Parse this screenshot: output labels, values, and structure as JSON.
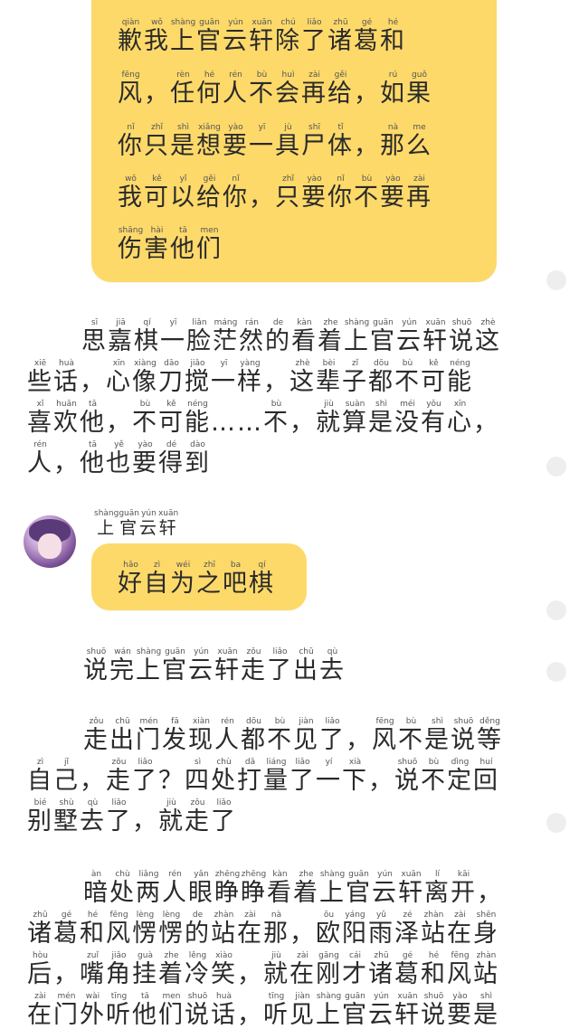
{
  "top_bubble": {
    "lines": [
      [
        [
          "歉",
          "qiàn"
        ],
        [
          "我",
          "wǒ"
        ],
        [
          "上",
          "shàng"
        ],
        [
          "官",
          "guān"
        ],
        [
          "云",
          "yún"
        ],
        [
          "轩",
          "xuān"
        ],
        [
          "除",
          "chú"
        ],
        [
          "了",
          "liǎo"
        ],
        [
          "诸",
          "zhū"
        ],
        [
          "葛",
          "gé"
        ],
        [
          "和",
          "hé"
        ]
      ],
      [
        [
          "风",
          "fēng"
        ],
        [
          "，",
          ""
        ],
        [
          "任",
          "rèn"
        ],
        [
          "何",
          "hé"
        ],
        [
          "人",
          "rén"
        ],
        [
          "不",
          "bù"
        ],
        [
          "会",
          "huì"
        ],
        [
          "再",
          "zài"
        ],
        [
          "给",
          "gěi"
        ],
        [
          "，",
          ""
        ],
        [
          "如",
          "rú"
        ],
        [
          "果",
          "guǒ"
        ]
      ],
      [
        [
          "你",
          "nǐ"
        ],
        [
          "只",
          "zhǐ"
        ],
        [
          "是",
          "shì"
        ],
        [
          "想",
          "xiǎng"
        ],
        [
          "要",
          "yào"
        ],
        [
          "一",
          "yī"
        ],
        [
          "具",
          "jù"
        ],
        [
          "尸",
          "shī"
        ],
        [
          "体",
          "tǐ"
        ],
        [
          "，",
          ""
        ],
        [
          "那",
          "nà"
        ],
        [
          "么",
          "me"
        ]
      ],
      [
        [
          "我",
          "wǒ"
        ],
        [
          "可",
          "kě"
        ],
        [
          "以",
          "yǐ"
        ],
        [
          "给",
          "gěi"
        ],
        [
          "你",
          "nǐ"
        ],
        [
          "，",
          ""
        ],
        [
          "只",
          "zhǐ"
        ],
        [
          "要",
          "yào"
        ],
        [
          "你",
          "nǐ"
        ],
        [
          "不",
          "bù"
        ],
        [
          "要",
          "yào"
        ],
        [
          "再",
          "zài"
        ]
      ],
      [
        [
          "伤",
          "shāng"
        ],
        [
          "害",
          "hài"
        ],
        [
          "他",
          "tā"
        ],
        [
          "们",
          "men"
        ]
      ]
    ]
  },
  "narration_1": {
    "lines": [
      [
        [
          "思",
          "sī"
        ],
        [
          "嘉",
          "jiā"
        ],
        [
          "棋",
          "qí"
        ],
        [
          "一",
          "yī"
        ],
        [
          "脸",
          "liǎn"
        ],
        [
          "茫",
          "máng"
        ],
        [
          "然",
          "rán"
        ],
        [
          "的",
          "de"
        ],
        [
          "看",
          "kàn"
        ],
        [
          "着",
          "zhe"
        ],
        [
          "上",
          "shàng"
        ],
        [
          "官",
          "guān"
        ],
        [
          "云",
          "yún"
        ],
        [
          "轩",
          "xuān"
        ],
        [
          "说",
          "shuō"
        ],
        [
          "这",
          "zhè"
        ]
      ],
      [
        [
          "些",
          "xiē"
        ],
        [
          "话",
          "huà"
        ],
        [
          "，",
          ""
        ],
        [
          "心",
          "xīn"
        ],
        [
          "像",
          "xiàng"
        ],
        [
          "刀",
          "dāo"
        ],
        [
          "搅",
          "jiǎo"
        ],
        [
          "一",
          "yī"
        ],
        [
          "样",
          "yàng"
        ],
        [
          "，",
          ""
        ],
        [
          "这",
          "zhè"
        ],
        [
          "辈",
          "bèi"
        ],
        [
          "子",
          "zǐ"
        ],
        [
          "都",
          "dōu"
        ],
        [
          "不",
          "bù"
        ],
        [
          "可",
          "kě"
        ],
        [
          "能",
          "néng"
        ]
      ],
      [
        [
          "喜",
          "xǐ"
        ],
        [
          "欢",
          "huān"
        ],
        [
          "他",
          "tā"
        ],
        [
          "，",
          ""
        ],
        [
          "不",
          "bù"
        ],
        [
          "可",
          "kě"
        ],
        [
          "能",
          "néng"
        ],
        [
          "……",
          ""
        ],
        [
          "不",
          "bù"
        ],
        [
          "，",
          ""
        ],
        [
          "就",
          "jiù"
        ],
        [
          "算",
          "suàn"
        ],
        [
          "是",
          "shì"
        ],
        [
          "没",
          "méi"
        ],
        [
          "有",
          "yǒu"
        ],
        [
          "心",
          "xīn"
        ],
        [
          "，",
          ""
        ]
      ],
      [
        [
          "人",
          "rén"
        ],
        [
          "，",
          ""
        ],
        [
          "他",
          "tā"
        ],
        [
          "也",
          "yě"
        ],
        [
          "要",
          "yào"
        ],
        [
          "得",
          "dé"
        ],
        [
          "到",
          "dào"
        ]
      ]
    ]
  },
  "chat": {
    "speaker": [
      [
        "上",
        "shàng"
      ],
      [
        "官",
        "guān"
      ],
      [
        "云",
        "yún"
      ],
      [
        "轩",
        "xuān"
      ]
    ],
    "message": [
      [
        "好",
        "hǎo"
      ],
      [
        "自",
        "zì"
      ],
      [
        "为",
        "wéi"
      ],
      [
        "之",
        "zhī"
      ],
      [
        "吧",
        "ba"
      ],
      [
        "棋",
        "qí"
      ]
    ]
  },
  "narration_2": {
    "lines": [
      [
        [
          "说",
          "shuō"
        ],
        [
          "完",
          "wán"
        ],
        [
          "上",
          "shàng"
        ],
        [
          "官",
          "guān"
        ],
        [
          "云",
          "yún"
        ],
        [
          "轩",
          "xuān"
        ],
        [
          "走",
          "zǒu"
        ],
        [
          "了",
          "liǎo"
        ],
        [
          "出",
          "chū"
        ],
        [
          "去",
          "qù"
        ]
      ]
    ]
  },
  "narration_3": {
    "lines": [
      [
        [
          "走",
          "zǒu"
        ],
        [
          "出",
          "chū"
        ],
        [
          "门",
          "mén"
        ],
        [
          "发",
          "fā"
        ],
        [
          "现",
          "xiàn"
        ],
        [
          "人",
          "rén"
        ],
        [
          "都",
          "dōu"
        ],
        [
          "不",
          "bù"
        ],
        [
          "见",
          "jiàn"
        ],
        [
          "了",
          "liǎo"
        ],
        [
          "，",
          ""
        ],
        [
          "风",
          "fēng"
        ],
        [
          "不",
          "bù"
        ],
        [
          "是",
          "shì"
        ],
        [
          "说",
          "shuō"
        ],
        [
          "等",
          "děng"
        ]
      ],
      [
        [
          "自",
          "zì"
        ],
        [
          "己",
          "jǐ"
        ],
        [
          "，",
          ""
        ],
        [
          "走",
          "zǒu"
        ],
        [
          "了",
          "liǎo"
        ],
        [
          "？",
          ""
        ],
        [
          "四",
          "sì"
        ],
        [
          "处",
          "chù"
        ],
        [
          "打",
          "dǎ"
        ],
        [
          "量",
          "liáng"
        ],
        [
          "了",
          "liǎo"
        ],
        [
          "一",
          "yí"
        ],
        [
          "下",
          "xià"
        ],
        [
          "，",
          ""
        ],
        [
          "说",
          "shuō"
        ],
        [
          "不",
          "bù"
        ],
        [
          "定",
          "dìng"
        ],
        [
          "回",
          "huí"
        ]
      ],
      [
        [
          "别",
          "bié"
        ],
        [
          "墅",
          "shù"
        ],
        [
          "去",
          "qù"
        ],
        [
          "了",
          "liǎo"
        ],
        [
          "，",
          ""
        ],
        [
          "就",
          "jiù"
        ],
        [
          "走",
          "zǒu"
        ],
        [
          "了",
          "liǎo"
        ]
      ]
    ]
  },
  "narration_4": {
    "lines": [
      [
        [
          "暗",
          "àn"
        ],
        [
          "处",
          "chù"
        ],
        [
          "两",
          "liǎng"
        ],
        [
          "人",
          "rén"
        ],
        [
          "眼",
          "yǎn"
        ],
        [
          "睁",
          "zhēng"
        ],
        [
          "睁",
          "zhēng"
        ],
        [
          "看",
          "kàn"
        ],
        [
          "着",
          "zhe"
        ],
        [
          "上",
          "shàng"
        ],
        [
          "官",
          "guān"
        ],
        [
          "云",
          "yún"
        ],
        [
          "轩",
          "xuān"
        ],
        [
          "离",
          "lí"
        ],
        [
          "开",
          "kāi"
        ],
        [
          "，",
          ""
        ]
      ],
      [
        [
          "诸",
          "zhū"
        ],
        [
          "葛",
          "gé"
        ],
        [
          "和",
          "hé"
        ],
        [
          "风",
          "fēng"
        ],
        [
          "愣",
          "lèng"
        ],
        [
          "愣",
          "lèng"
        ],
        [
          "的",
          "de"
        ],
        [
          "站",
          "zhàn"
        ],
        [
          "在",
          "zài"
        ],
        [
          "那",
          "nà"
        ],
        [
          "，",
          ""
        ],
        [
          "欧",
          "ōu"
        ],
        [
          "阳",
          "yáng"
        ],
        [
          "雨",
          "yǔ"
        ],
        [
          "泽",
          "zé"
        ],
        [
          "站",
          "zhàn"
        ],
        [
          "在",
          "zài"
        ],
        [
          "身",
          "shēn"
        ]
      ],
      [
        [
          "后",
          "hòu"
        ],
        [
          "，",
          ""
        ],
        [
          "嘴",
          "zuǐ"
        ],
        [
          "角",
          "jiǎo"
        ],
        [
          "挂",
          "guà"
        ],
        [
          "着",
          "zhe"
        ],
        [
          "冷",
          "lěng"
        ],
        [
          "笑",
          "xiào"
        ],
        [
          "，",
          ""
        ],
        [
          "就",
          "jiù"
        ],
        [
          "在",
          "zài"
        ],
        [
          "刚",
          "gāng"
        ],
        [
          "才",
          "cái"
        ],
        [
          "诸",
          "zhū"
        ],
        [
          "葛",
          "gé"
        ],
        [
          "和",
          "hé"
        ],
        [
          "风",
          "fēng"
        ],
        [
          "站",
          "zhàn"
        ]
      ],
      [
        [
          "在",
          "zài"
        ],
        [
          "门",
          "mén"
        ],
        [
          "外",
          "wài"
        ],
        [
          "听",
          "tīng"
        ],
        [
          "他",
          "tā"
        ],
        [
          "们",
          "men"
        ],
        [
          "说",
          "shuō"
        ],
        [
          "话",
          "huà"
        ],
        [
          "，",
          ""
        ],
        [
          "听",
          "tīng"
        ],
        [
          "见",
          "jiàn"
        ],
        [
          "上",
          "shàng"
        ],
        [
          "官",
          "guān"
        ],
        [
          "云",
          "yún"
        ],
        [
          "轩",
          "xuān"
        ],
        [
          "说",
          "shuō"
        ],
        [
          "要",
          "yào"
        ],
        [
          "是",
          "shì"
        ]
      ]
    ]
  }
}
